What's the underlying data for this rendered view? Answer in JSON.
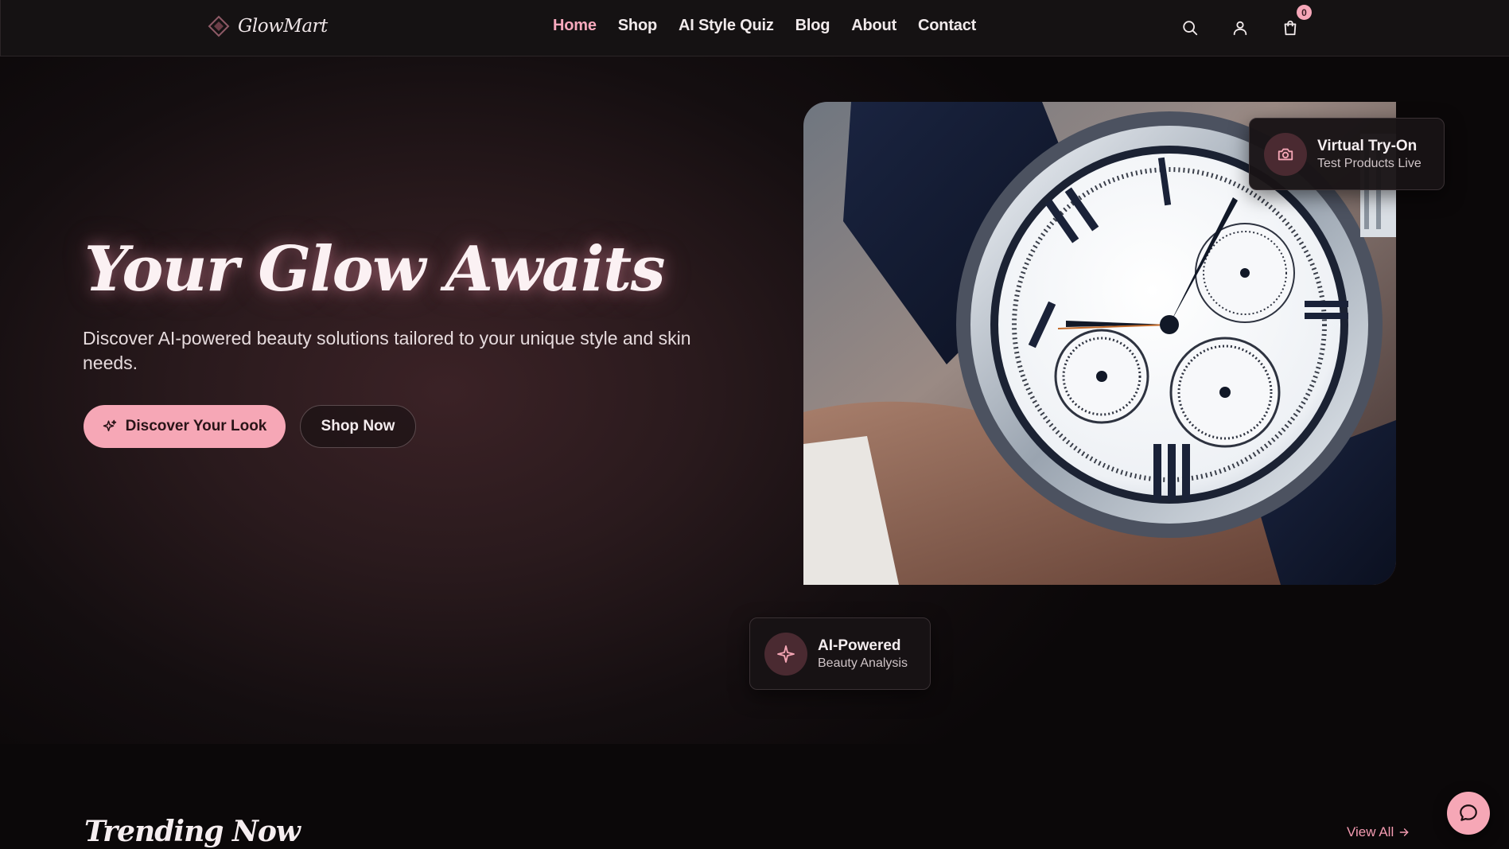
{
  "brand": {
    "name": "GlowMart",
    "logo_icon": "diamond-icon"
  },
  "nav": {
    "items": [
      {
        "label": "Home",
        "active": true
      },
      {
        "label": "Shop",
        "active": false
      },
      {
        "label": "AI Style Quiz",
        "active": false
      },
      {
        "label": "Blog",
        "active": false
      },
      {
        "label": "About",
        "active": false
      },
      {
        "label": "Contact",
        "active": false
      }
    ]
  },
  "header_actions": {
    "search_icon": "search-icon",
    "account_icon": "user-icon",
    "cart_icon": "shopping-bag-icon",
    "cart_count": "0"
  },
  "hero": {
    "title": "Your Glow Awaits",
    "subtitle": "Discover AI-powered beauty solutions tailored to your unique style and skin needs.",
    "primary_cta": "Discover Your Look",
    "primary_cta_icon": "sparkles-icon",
    "secondary_cta": "Shop Now",
    "image_subject": "wristwatch"
  },
  "badges": {
    "tryon": {
      "title": "Virtual Try-On",
      "subtitle": "Test Products Live",
      "icon": "camera-icon"
    },
    "ai": {
      "title": "AI-Powered",
      "subtitle": "Beauty Analysis",
      "icon": "sparkle-icon"
    }
  },
  "trending": {
    "title": "Trending Now",
    "view_all": "View All"
  },
  "chat": {
    "icon": "chat-bubble-icon"
  },
  "colors": {
    "accent": "#f6a7b6",
    "accent_text": "#f7a9bd",
    "background": "#0b0809",
    "header_bg": "#151213"
  }
}
